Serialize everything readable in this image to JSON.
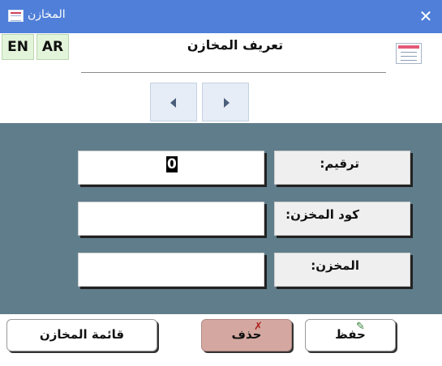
{
  "window": {
    "title": "المخازن",
    "close_glyph": "✕",
    "title_icon": "form-icon"
  },
  "language": {
    "en": "EN",
    "ar": "AR"
  },
  "form": {
    "title": "تعريف المخازن",
    "icon": "form-icon"
  },
  "navigation": {
    "prev_icon": "triangle-left-icon",
    "next_icon": "triangle-right-icon"
  },
  "fields": [
    {
      "label": "ترقيم:",
      "value": "0"
    },
    {
      "label": "كود المخزن:",
      "value": ""
    },
    {
      "label": "المخزن:",
      "value": ""
    }
  ],
  "buttons": {
    "list": "قائمة المخازن",
    "delete": "حذف",
    "delete_icon": "✗",
    "save": "حفظ",
    "save_icon": "✎"
  },
  "colors": {
    "titlebar": "#4f7fd8",
    "detail_background": "#607d8b",
    "delete_button": "#d4a8a0"
  }
}
